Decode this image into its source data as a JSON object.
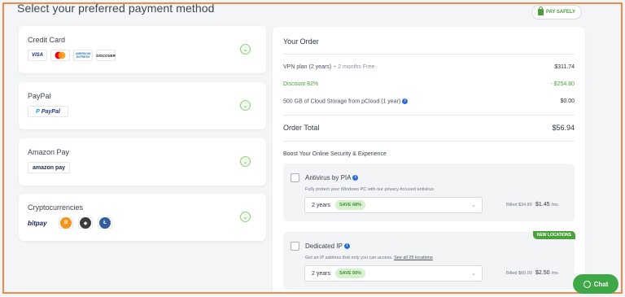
{
  "header": {
    "title": "Select your preferred payment method",
    "badge": "PAY SAFELY",
    "badge_icon": "lock-icon"
  },
  "payment_methods": [
    {
      "label": "Credit Card",
      "logos": [
        "VISA",
        "",
        "AMERICAN EXPRESS",
        "DISCOVER"
      ]
    },
    {
      "label": "PayPal",
      "logos": [
        "PayPal"
      ]
    },
    {
      "label": "Amazon Pay",
      "logos": [
        "amazon pay"
      ]
    },
    {
      "label": "Cryptocurrencies",
      "logos": [
        "bitpay",
        "B",
        "",
        "Ł"
      ]
    }
  ],
  "order": {
    "title": "Your Order",
    "plan_label": "VPN plan (2 years)",
    "plan_bonus": "+ 2 months Free",
    "plan_price": "$311.74",
    "discount_label": "Discount 82%",
    "discount_value": "- $254.80",
    "storage_label": "500 GB of Cloud Storage from pCloud (1 year)",
    "storage_price": "$0.00",
    "total_label": "Order Total",
    "total_value": "$56.94",
    "boost_title": "Boost Your Online Security & Experience"
  },
  "addons": [
    {
      "name": "Antivirus by PIA",
      "description": "Fully protect your Windows PC with our privacy-focused antivirus",
      "link": "",
      "term": "2 years",
      "save": "SAVE 68%",
      "billed": "Billed $34.80",
      "price": "$1.45",
      "per": "/mo.",
      "badge": ""
    },
    {
      "name": "Dedicated IP",
      "description": "Get an IP address that only you can access.",
      "link": "See all 25 locations",
      "term": "2 years",
      "save": "SAVE 50%",
      "billed": "Billed $60.00",
      "price": "$2.50",
      "per": "/mo.",
      "badge": "NEW LOCATIONS"
    }
  ],
  "chat": {
    "label": "Chat"
  },
  "colors": {
    "accent": "#4aa33a",
    "frame": "#f08a4b",
    "info": "#2a6fd6"
  }
}
